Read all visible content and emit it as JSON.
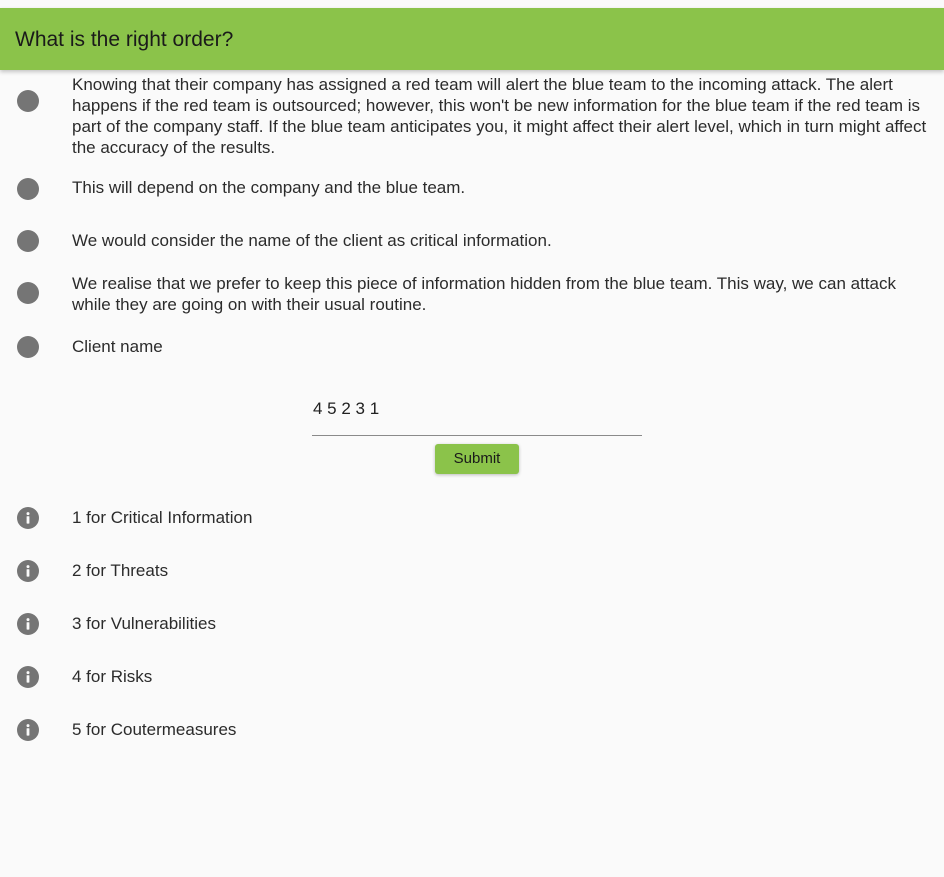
{
  "header": {
    "title": "What is the right order?"
  },
  "options": [
    {
      "icon": "radio-icon",
      "text": "Knowing that their company has assigned a red team will alert the blue team to the incoming attack. The alert happens if the red team is outsourced; however, this won't be new information for the blue team if the red team is part of the company staff. If the blue team anticipates you, it might affect their alert level, which in turn might affect the accuracy of the results."
    },
    {
      "icon": "radio-icon",
      "text": "This will depend on the company and the blue team."
    },
    {
      "icon": "radio-icon",
      "text": "We would consider the name of the client as critical information."
    },
    {
      "icon": "radio-icon",
      "text": "We realise that we prefer to keep this piece of information hidden from the blue team. This way, we can attack while they are going on with their usual routine."
    },
    {
      "icon": "radio-icon",
      "text": "Client name"
    }
  ],
  "answer": {
    "value": "4 5 2 3 1"
  },
  "submit": {
    "label": "Submit"
  },
  "legend": [
    {
      "icon": "info-icon",
      "text": "1 for Critical Information"
    },
    {
      "icon": "info-icon",
      "text": "2 for Threats"
    },
    {
      "icon": "info-icon",
      "text": "3 for Vulnerabilities"
    },
    {
      "icon": "info-icon",
      "text": "4 for Risks"
    },
    {
      "icon": "info-icon",
      "text": "5 for Coutermeasures"
    }
  ],
  "colors": {
    "accent": "#8bc34a",
    "icon": "#757575",
    "background": "#fafafa"
  }
}
